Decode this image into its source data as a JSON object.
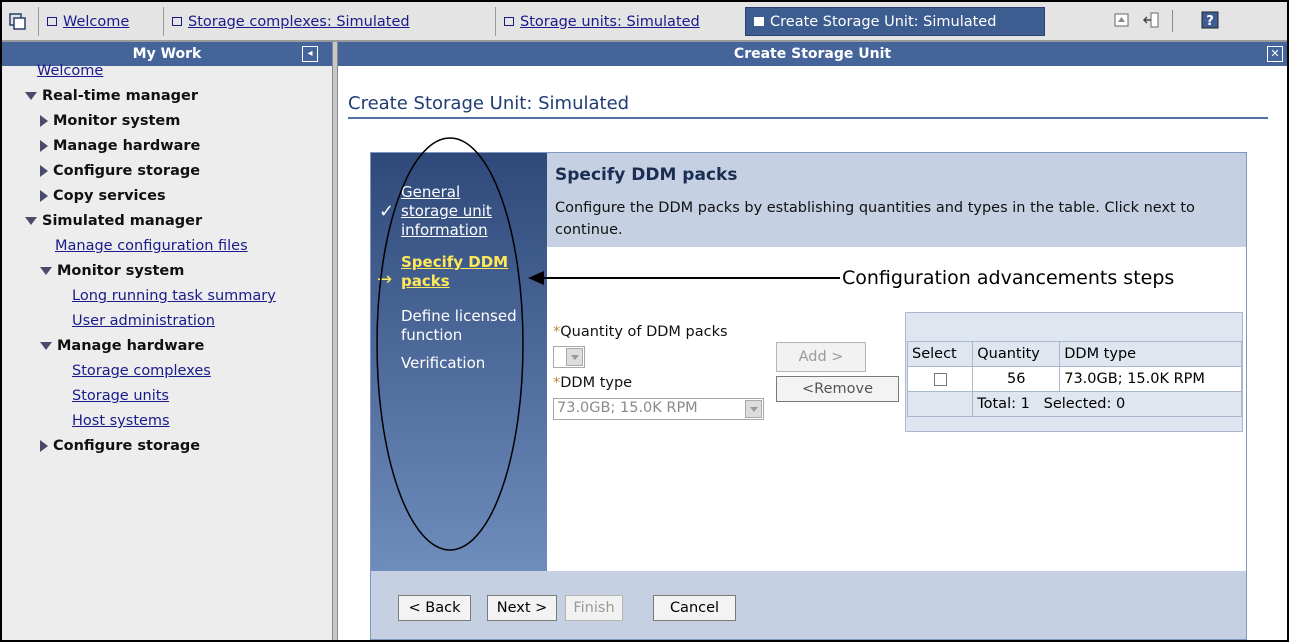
{
  "tabs": [
    {
      "label": "Welcome",
      "active": false
    },
    {
      "label": "Storage complexes: Simulated",
      "active": false
    },
    {
      "label": "Storage units: Simulated",
      "active": false
    },
    {
      "label": "Create Storage Unit: Simulated",
      "active": true
    }
  ],
  "nav": {
    "title": "My Work",
    "items": [
      {
        "label": "Welcome",
        "type": "link"
      },
      {
        "label": "Real-time manager",
        "type": "group-open"
      },
      {
        "label": "Monitor system",
        "type": "group-closed"
      },
      {
        "label": "Manage hardware",
        "type": "group-closed"
      },
      {
        "label": "Configure storage",
        "type": "group-closed"
      },
      {
        "label": "Copy services",
        "type": "group-closed"
      },
      {
        "label": "Simulated manager",
        "type": "group-open"
      },
      {
        "label": "Manage configuration files",
        "type": "link"
      },
      {
        "label": "Monitor system",
        "type": "group-open"
      },
      {
        "label": "Long running task summary",
        "type": "link"
      },
      {
        "label": "User administration",
        "type": "link"
      },
      {
        "label": "Manage hardware",
        "type": "group-open"
      },
      {
        "label": "Storage complexes",
        "type": "link"
      },
      {
        "label": "Storage units",
        "type": "link"
      },
      {
        "label": "Host systems",
        "type": "link"
      },
      {
        "label": "Configure storage",
        "type": "group-closed"
      }
    ]
  },
  "main": {
    "header": "Create Storage Unit",
    "page_title": "Create Storage Unit: Simulated"
  },
  "wizard": {
    "steps": {
      "general": "General storage unit information",
      "current": "Specify DDM packs",
      "licensed": "Define licensed function",
      "verification": "Verification"
    },
    "section_title": "Specify DDM packs",
    "section_desc": "Configure the DDM packs by establishing quantities and types in the table. Click next to continue.",
    "required_mark": "*",
    "quantity_label": "Quantity of DDM packs",
    "ddm_type_label": "DDM type",
    "ddm_type_value": "73.0GB; 15.0K RPM",
    "add_label": "Add >",
    "remove_label": "<Remove",
    "table": {
      "columns": [
        "Select",
        "Quantity",
        "DDM type"
      ],
      "rows": [
        {
          "quantity": "56",
          "ddm_type": "73.0GB; 15.0K RPM"
        }
      ],
      "total": "Total: 1",
      "selected": "Selected: 0"
    },
    "buttons": {
      "back": "< Back",
      "next": "Next >",
      "finish": "Finish",
      "cancel": "Cancel"
    }
  },
  "annotation": "Configuration advancements steps",
  "colors": {
    "header_bar": "#44649a",
    "wizard_panel": "#c5d1e2",
    "current_step": "#ffe85a"
  }
}
